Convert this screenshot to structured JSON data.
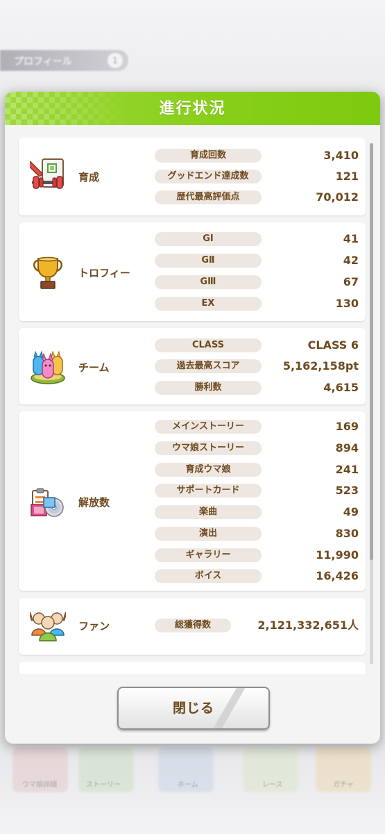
{
  "background": {
    "tab_label": "プロフィール",
    "tab_number": "1",
    "nav_labels": [
      "ウマ娘詳細",
      "ストーリー",
      "ホーム",
      "レース",
      "ガチャ"
    ]
  },
  "dialog": {
    "title": "進行状況",
    "close_label": "閉じる"
  },
  "sections": [
    {
      "name": "育成",
      "icon": "training-icon",
      "rows": [
        {
          "label": "育成回数",
          "value": "3,410"
        },
        {
          "label": "グッドエンド達成数",
          "value": "121"
        },
        {
          "label": "歴代最高評価点",
          "value": "70,012"
        }
      ]
    },
    {
      "name": "トロフィー",
      "icon": "trophy-icon",
      "rows": [
        {
          "label": "GⅠ",
          "value": "41"
        },
        {
          "label": "GⅡ",
          "value": "42"
        },
        {
          "label": "GⅢ",
          "value": "67"
        },
        {
          "label": "EX",
          "value": "130"
        }
      ]
    },
    {
      "name": "チーム",
      "icon": "team-icon",
      "rows": [
        {
          "label": "CLASS",
          "value": "CLASS 6"
        },
        {
          "label": "過去最高スコア",
          "value": "5,162,158pt"
        },
        {
          "label": "勝利数",
          "value": "4,615"
        }
      ]
    },
    {
      "name": "解放数",
      "icon": "unlock-icon",
      "rows": [
        {
          "label": "メインストーリー",
          "value": "169"
        },
        {
          "label": "ウマ娘ストーリー",
          "value": "894"
        },
        {
          "label": "育成ウマ娘",
          "value": "241"
        },
        {
          "label": "サポートカード",
          "value": "523"
        },
        {
          "label": "楽曲",
          "value": "49"
        },
        {
          "label": "演出",
          "value": "830"
        },
        {
          "label": "ギャラリー",
          "value": "11,990"
        },
        {
          "label": "ボイス",
          "value": "16,426"
        }
      ]
    },
    {
      "name": "ファン",
      "icon": "fans-icon",
      "rows": [
        {
          "label": "総獲得数",
          "value": "2,121,332,651人"
        }
      ]
    }
  ],
  "colors": {
    "header_green": "#88cf1a",
    "text_brown": "#6e4a1f",
    "label_pill": "#eee7e1"
  }
}
